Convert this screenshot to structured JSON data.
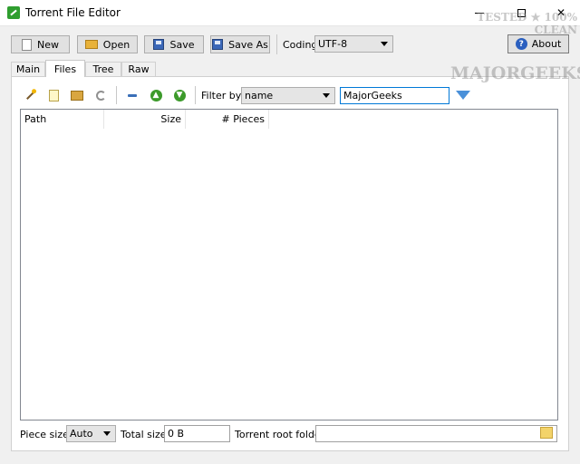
{
  "window": {
    "title": "Torrent File Editor",
    "minimize": "",
    "maximize": "",
    "close": "✕"
  },
  "toolbar": {
    "new_label": "New",
    "open_label": "Open",
    "save_label": "Save",
    "save_as_label": "Save As",
    "coding_label": "Coding",
    "coding_value": "UTF-8",
    "about_label": "About"
  },
  "tabs": [
    {
      "label": "Main"
    },
    {
      "label": "Files",
      "active": true
    },
    {
      "label": "Tree"
    },
    {
      "label": "Raw"
    }
  ],
  "files_toolbar": {
    "icons": [
      "magic-wand-icon",
      "add-file-icon",
      "add-folder-icon",
      "refresh-icon",
      "remove-icon",
      "move-up-icon",
      "move-down-icon"
    ],
    "filter_by_label": "Filter by",
    "filter_field": "name",
    "filter_value": "MajorGeeks",
    "filter_icon": "funnel-icon"
  },
  "files_table": {
    "columns": [
      "Path",
      "Size",
      "# Pieces"
    ],
    "rows": []
  },
  "footer": {
    "piece_size_label": "Piece size",
    "piece_size_value": "Auto",
    "total_size_label": "Total size",
    "total_size_value": "0 B",
    "root_folder_label": "Torrent root folder",
    "root_folder_value": ""
  },
  "watermark": {
    "line1": "TESTED ★ 100% CLEAN",
    "line2": "MAJORGEEKS"
  },
  "colors": {
    "accent": "#0078d7",
    "window_bg": "#f0f0f0",
    "panel_bg": "#ffffff"
  }
}
